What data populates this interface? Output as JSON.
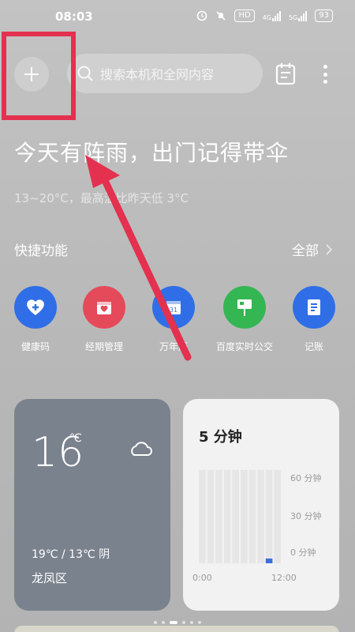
{
  "status_bar": {
    "time": "08:03",
    "icons": [
      "alarm-icon",
      "mute-icon",
      "hd-icon",
      "signal-4g-icon",
      "signal-5g-icon"
    ],
    "hd_label": "HD",
    "net_4g": "4G",
    "net_5g": "5G",
    "battery": "93"
  },
  "top_bar": {
    "plus_icon": "plus-icon",
    "search_placeholder": "搜索本机和全网内容",
    "calendar_icon": "calendar-icon",
    "more_icon": "more-vertical-icon"
  },
  "weather": {
    "headline": "今天有阵雨，出门记得带伞",
    "sub": "13~20°C，最高温比昨天低 3°C"
  },
  "shortcuts_section": {
    "title": "快捷功能",
    "all_label": "全部",
    "items": [
      {
        "label": "健康码",
        "icon": "health-code-icon",
        "color": "#2f6ee6"
      },
      {
        "label": "经期管理",
        "icon": "period-calendar-icon",
        "color": "#e44a5a"
      },
      {
        "label": "万年历",
        "icon": "calendar-31-icon",
        "color": "#2f6ee6",
        "day": "31"
      },
      {
        "label": "百度实时公交",
        "icon": "bus-stop-icon",
        "color": "#34b653"
      },
      {
        "label": "记账",
        "icon": "ledger-icon",
        "color": "#2f6ee6"
      }
    ]
  },
  "weather_card": {
    "temp": "16",
    "unit": "℃",
    "range": "19℃ / 13℃  阴",
    "district": "龙凤区",
    "icon": "cloud-icon"
  },
  "screen_time_card": {
    "title": "5 分钟",
    "y_labels": [
      "60 分钟",
      "30 分钟",
      "0 分钟"
    ],
    "x_labels": [
      "0:00",
      "12:00"
    ]
  },
  "chart_data": {
    "type": "bar",
    "title": "5 分钟",
    "yticks": [
      "60 分钟",
      "30 分钟",
      "0 分钟"
    ],
    "xticks": [
      "0:00",
      "12:00"
    ],
    "ylim": [
      0,
      60
    ],
    "series": [
      {
        "values": [
          0,
          0,
          0,
          0,
          0,
          0,
          0,
          0,
          3,
          0
        ],
        "color": "#3b6fe0"
      }
    ]
  },
  "colors": {
    "highlight": "#e3314f",
    "arrow": "#e3314f"
  }
}
